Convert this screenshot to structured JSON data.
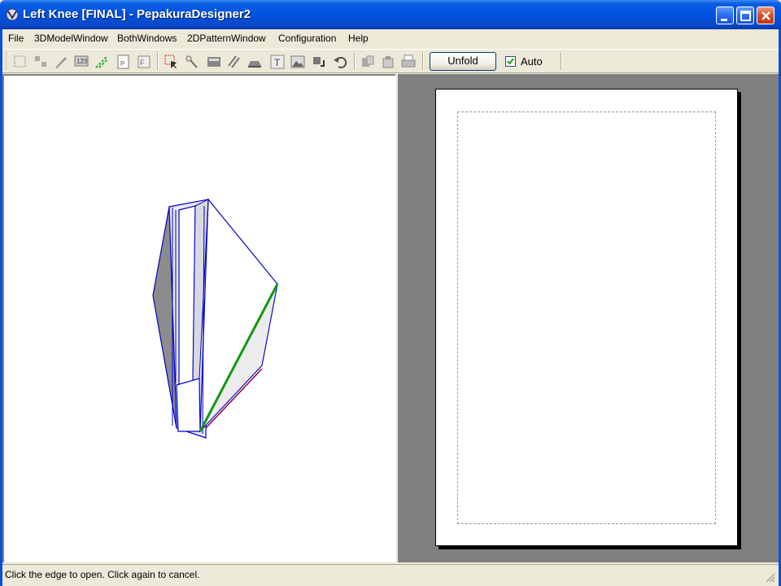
{
  "window": {
    "title": "Left Knee [FINAL] - PepakuraDesigner2",
    "app_icon": "pepakura-icon",
    "controls": [
      "minimize-icon",
      "maximize-icon",
      "close-icon"
    ],
    "colors": {
      "titlebar": "#0052e0",
      "close_button": "#d84c24"
    }
  },
  "menu": {
    "file": "File",
    "model3d": "3DModelWindow",
    "both": "BothWindows",
    "pattern2d": "2DPatternWindow",
    "config": "Configuration",
    "help": "Help"
  },
  "toolbar": {
    "icons": [
      "select-faces-icon",
      "arrange-parts-icon",
      "edit-icon",
      "number-icon",
      "fold-lines-icon",
      "page-icon",
      "face-settings-icon",
      "select-tool-icon",
      "join-edge-icon",
      "texture-icon",
      "fold-line-style-icon",
      "flaps-icon",
      "text-icon",
      "image-icon",
      "rotate-icon",
      "undo-icon",
      "cut-icon",
      "copy-icon",
      "print-icon"
    ],
    "unfold_label": "Unfold",
    "auto_label": "Auto",
    "auto_checked": true
  },
  "views": {
    "model3d": {
      "background": "#ffffff",
      "edge_color": "#0000cc",
      "highlight_edge_color": "#119911"
    },
    "pattern2d": {
      "background": "#808080",
      "paper_color": "#ffffff",
      "print_area": "dashed"
    }
  },
  "status": {
    "text": "Click the edge to open. Click again to cancel."
  }
}
